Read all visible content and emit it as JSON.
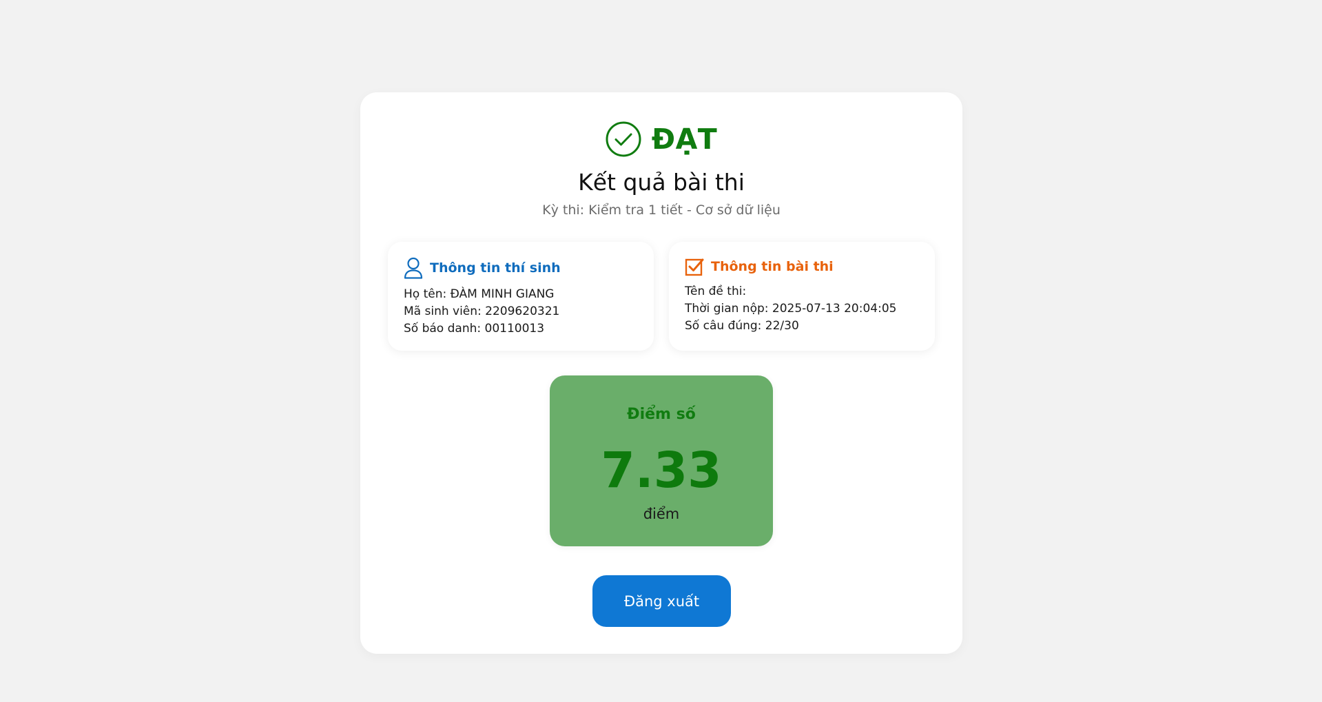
{
  "status": {
    "text": "ĐẠT",
    "color": "#107c10",
    "icon": "check-circle-icon"
  },
  "page": {
    "title": "Kết quả bài thi",
    "exam_subtitle": "Kỳ thi: Kiểm tra 1 tiết - Cơ sở dữ liệu"
  },
  "candidate_panel": {
    "title": "Thông tin thí sinh",
    "icon": "person-icon",
    "accent_color": "#0f6cbd",
    "lines": [
      "Họ tên: ĐÀM MINH GIANG",
      "Mã sinh viên: 2209620321",
      "Số báo danh: 00110013"
    ]
  },
  "exam_panel": {
    "title": "Thông tin bài thi",
    "icon": "checkbox-checked-icon",
    "accent_color": "#e8620c",
    "lines": [
      "Tên đề thi:",
      "Thời gian nộp: 2025-07-13 20:04:05",
      "Số câu đúng: 22/30"
    ]
  },
  "score": {
    "label": "Điểm số",
    "value": "7.33",
    "unit": "điểm",
    "box_color": "#6aae6a"
  },
  "actions": {
    "logout_label": "Đăng xuất",
    "button_color": "#0f78d4"
  }
}
